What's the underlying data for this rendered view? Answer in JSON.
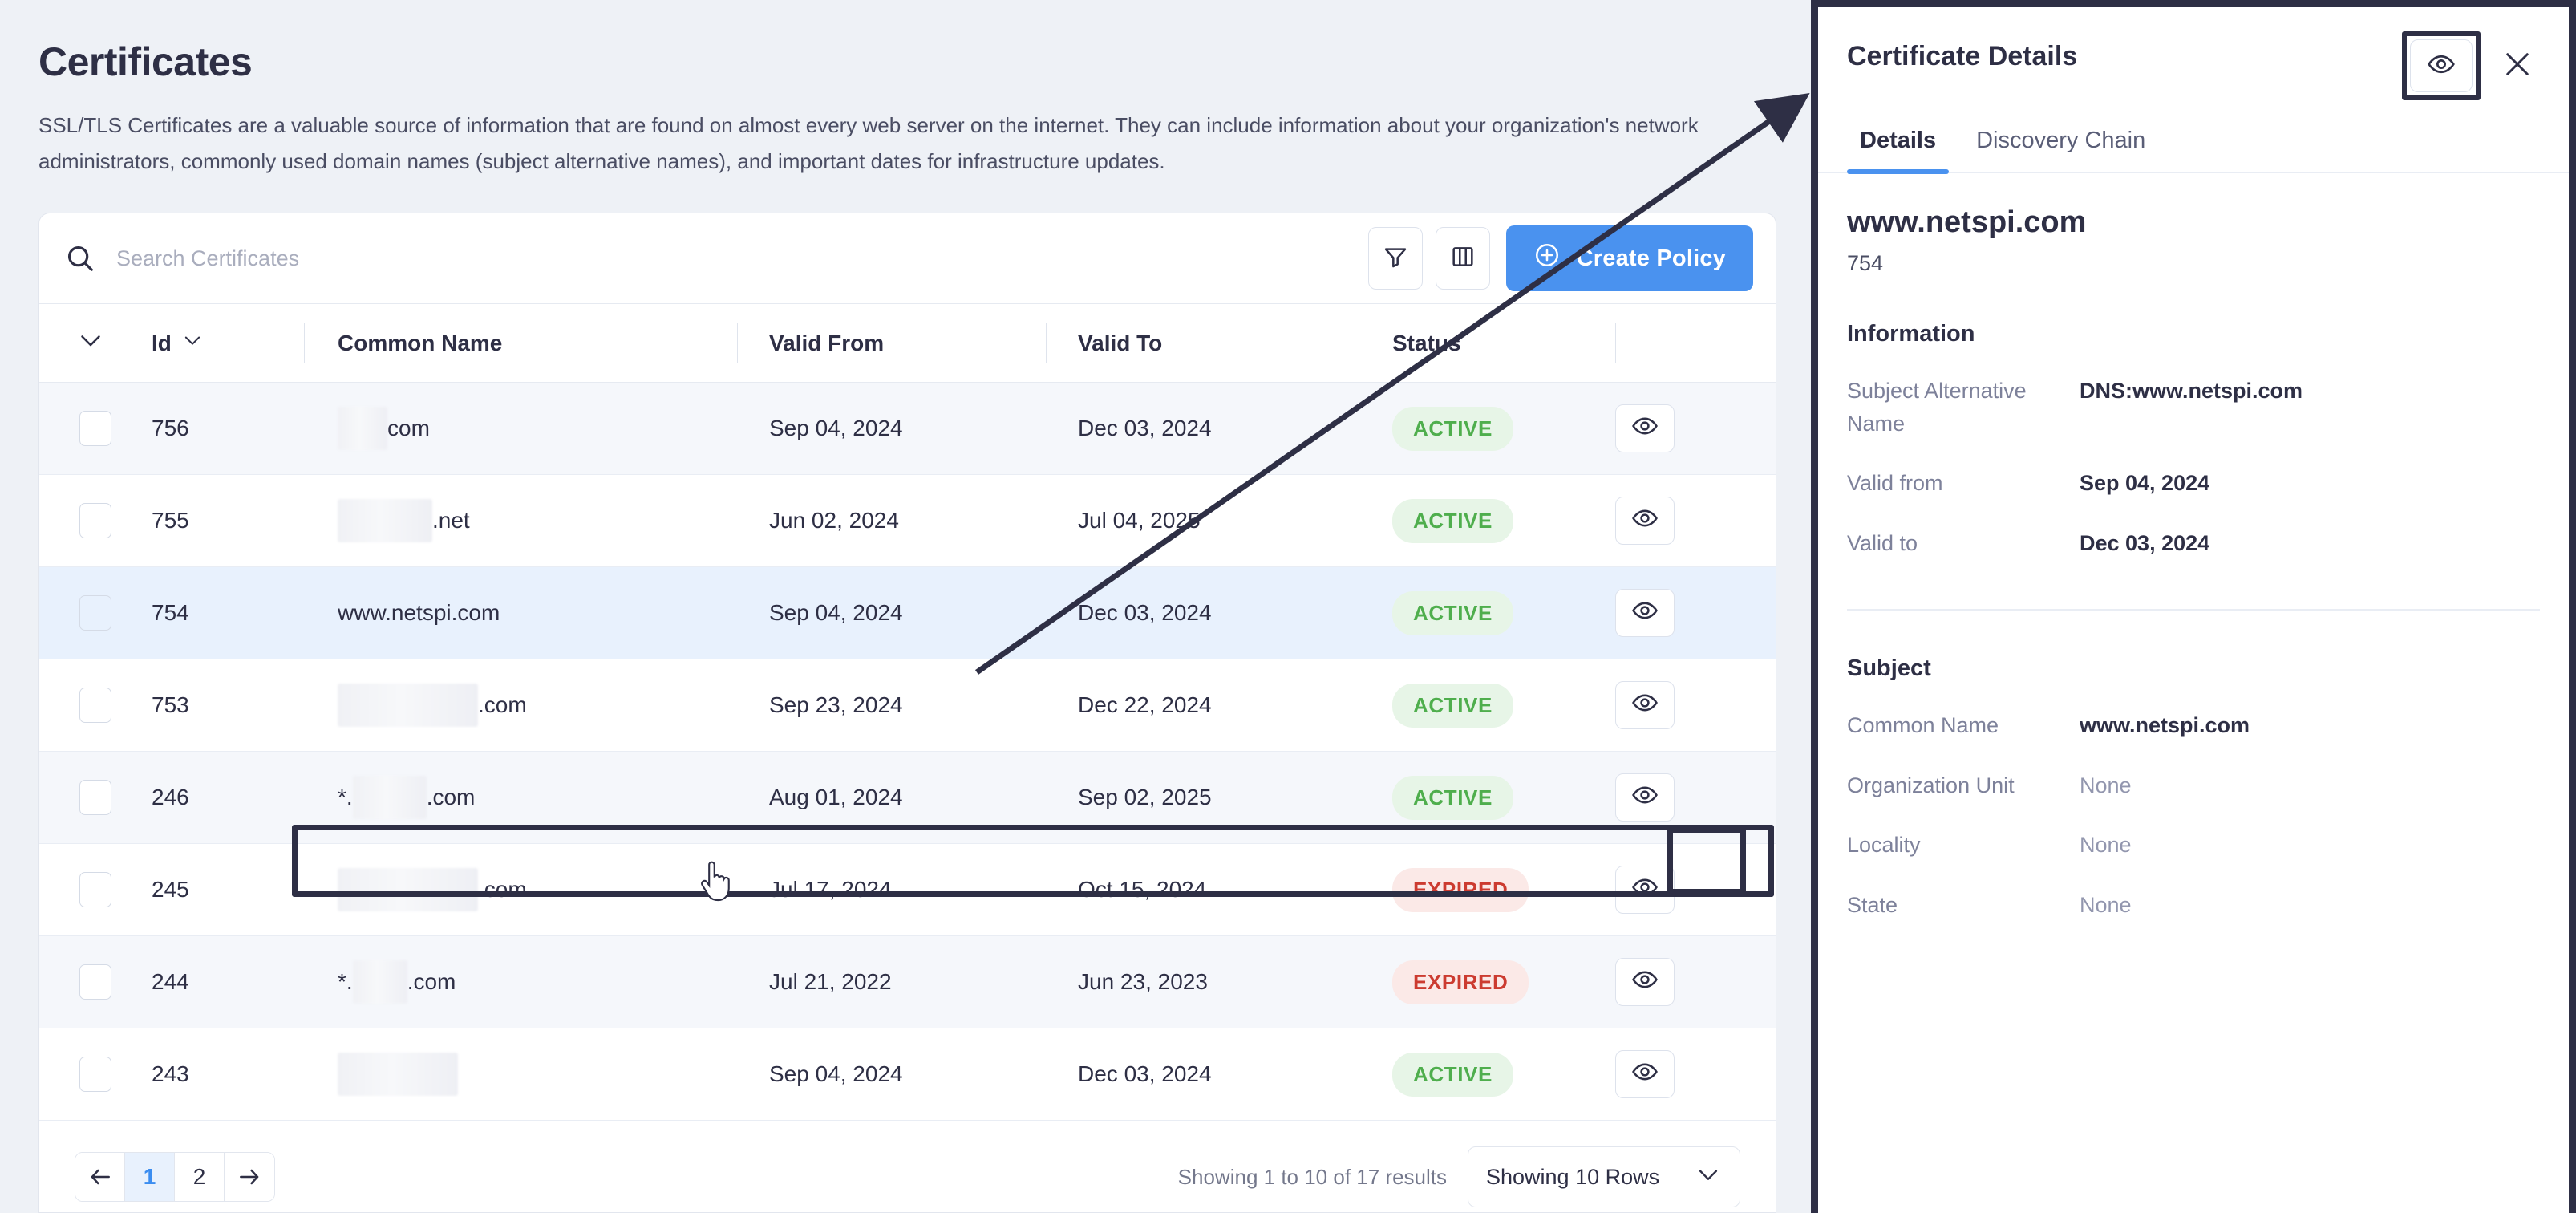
{
  "page": {
    "title": "Certificates",
    "description": "SSL/TLS Certificates are a valuable source of information that are found on almost every web server on the internet. They can include information about your organization's network administrators, commonly used domain names (subject alternative names), and important dates for infrastructure updates."
  },
  "toolbar": {
    "search_placeholder": "Search Certificates",
    "search_value": "",
    "search_icon": "search-icon",
    "filter_icon": "filter-icon",
    "columns_icon": "columns-icon",
    "create_policy_label": "Create Policy",
    "create_policy_icon": "plus-circle-icon",
    "accent_color": "#4a92ef"
  },
  "table": {
    "columns": [
      {
        "key": "select",
        "label": ""
      },
      {
        "key": "id",
        "label": "Id"
      },
      {
        "key": "common_name",
        "label": "Common Name"
      },
      {
        "key": "valid_from",
        "label": "Valid From"
      },
      {
        "key": "valid_to",
        "label": "Valid To"
      },
      {
        "key": "status",
        "label": "Status"
      },
      {
        "key": "actions",
        "label": ""
      }
    ],
    "rows": [
      {
        "id": "756",
        "common_name": "com",
        "redact_width": 62,
        "valid_from": "Sep 04, 2024",
        "valid_to": "Dec 03, 2024",
        "status": "ACTIVE",
        "selected": false
      },
      {
        "id": "755",
        "common_name": ".net",
        "redact_width": 118,
        "valid_from": "Jun 02, 2024",
        "valid_to": "Jul 04, 2025",
        "status": "ACTIVE",
        "selected": false
      },
      {
        "id": "754",
        "common_name": "www.netspi.com",
        "redact_width": 0,
        "valid_from": "Sep 04, 2024",
        "valid_to": "Dec 03, 2024",
        "status": "ACTIVE",
        "selected": true
      },
      {
        "id": "753",
        "common_name": ".com",
        "redact_width": 175,
        "valid_from": "Sep 23, 2024",
        "valid_to": "Dec 22, 2024",
        "status": "ACTIVE",
        "selected": false
      },
      {
        "id": "246",
        "common_name": "*.",
        "redact_width": 92,
        "suffix": ".com",
        "valid_from": "Aug 01, 2024",
        "valid_to": "Sep 02, 2025",
        "status": "ACTIVE",
        "selected": false
      },
      {
        "id": "245",
        "common_name": ".com",
        "redact_width": 175,
        "valid_from": "Jul 17, 2024",
        "valid_to": "Oct 15, 2024",
        "status": "EXPIRED",
        "selected": false
      },
      {
        "id": "244",
        "common_name": "*.",
        "redact_width": 68,
        "suffix": ".com",
        "valid_from": "Jul 21, 2022",
        "valid_to": "Jun 23, 2023",
        "status": "EXPIRED",
        "selected": false
      },
      {
        "id": "243",
        "common_name": "",
        "redact_width": 150,
        "valid_from": "Sep 04, 2024",
        "valid_to": "Dec 03, 2024",
        "status": "ACTIVE",
        "selected": false
      }
    ],
    "row_action_icon": "eye-icon",
    "status_colors": {
      "active_text": "#4fae4d",
      "active_bg": "#e7f5e7",
      "expired_text": "#cc3b30",
      "expired_bg": "#fbe9e7"
    }
  },
  "pagination": {
    "prev_icon": "arrow-left-icon",
    "next_icon": "arrow-right-icon",
    "pages": [
      "1",
      "2"
    ],
    "current_page": "1",
    "results_text": "Showing 1 to 10 of 17 results",
    "rows_per_page_label": "Showing 10 Rows",
    "rows_chevron_icon": "chevron-down-icon"
  },
  "panel": {
    "title": "Certificate Details",
    "eye_icon": "eye-icon",
    "close_icon": "close-icon",
    "tabs": [
      {
        "label": "Details",
        "active": true
      },
      {
        "label": "Discovery Chain",
        "active": false
      }
    ],
    "cert_common_name": "www.netspi.com",
    "cert_id": "754",
    "information": {
      "section_label": "Information",
      "fields": [
        {
          "label": "Subject Alternative Name",
          "value": "DNS:www.netspi.com",
          "muted": false
        },
        {
          "label": "Valid from",
          "value": "Sep 04, 2024",
          "muted": false
        },
        {
          "label": "Valid to",
          "value": "Dec 03, 2024",
          "muted": false
        }
      ]
    },
    "subject": {
      "section_label": "Subject",
      "fields": [
        {
          "label": "Common Name",
          "value": "www.netspi.com",
          "muted": false
        },
        {
          "label": "Organization Unit",
          "value": "None",
          "muted": true
        },
        {
          "label": "Locality",
          "value": "None",
          "muted": true
        },
        {
          "label": "State",
          "value": "None",
          "muted": true
        }
      ]
    }
  }
}
